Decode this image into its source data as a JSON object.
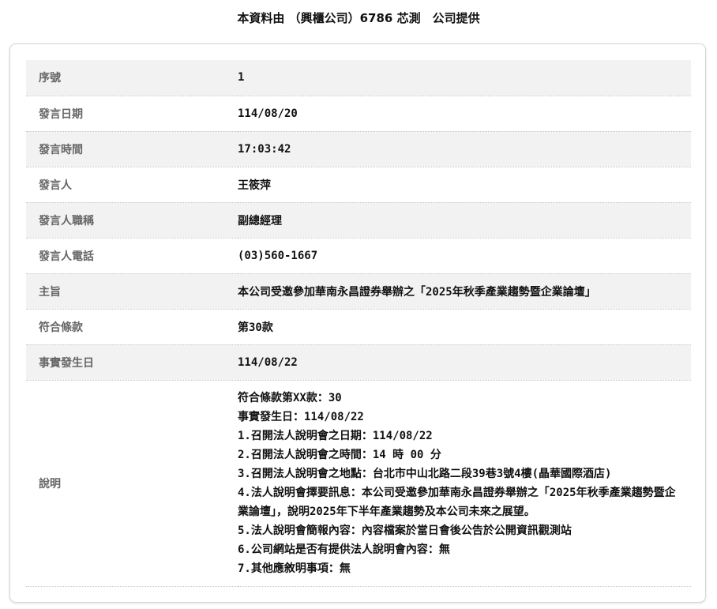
{
  "title": "本資料由 （興櫃公司）6786 芯測　公司提供",
  "rows": [
    {
      "label": "序號",
      "value": "1"
    },
    {
      "label": "發言日期",
      "value": "114/08/20"
    },
    {
      "label": "發言時間",
      "value": "17:03:42"
    },
    {
      "label": "發言人",
      "value": "王筱萍"
    },
    {
      "label": "發言人職稱",
      "value": "副總經理"
    },
    {
      "label": "發言人電話",
      "value": "(03)560-1667"
    },
    {
      "label": "主旨",
      "value": "本公司受邀參加華南永昌證券舉辦之「2025年秋季產業趨勢暨企業論壇」"
    },
    {
      "label": "符合條款",
      "value": "第30款"
    },
    {
      "label": "事實發生日",
      "value": "114/08/22"
    }
  ],
  "description": {
    "label": "說明",
    "lines": [
      "符合條款第XX款：30",
      "事實發生日：114/08/22",
      "1.召開法人說明會之日期：114/08/22",
      "2.召開法人說明會之時間：14 時 00 分",
      "3.召開法人說明會之地點：台北市中山北路二段39巷3號4樓(晶華國際酒店)",
      "4.法人說明會擇要訊息：本公司受邀參加華南永昌證券舉辦之「2025年秋季產業趨勢暨企業論壇」，說明2025年下半年產業趨勢及本公司未來之展望。",
      "5.法人說明會簡報內容：內容檔案於當日會後公告於公開資訊觀測站",
      "6.公司網站是否有提供法人說明會內容：無",
      "7.其他應敘明事項：無"
    ]
  }
}
